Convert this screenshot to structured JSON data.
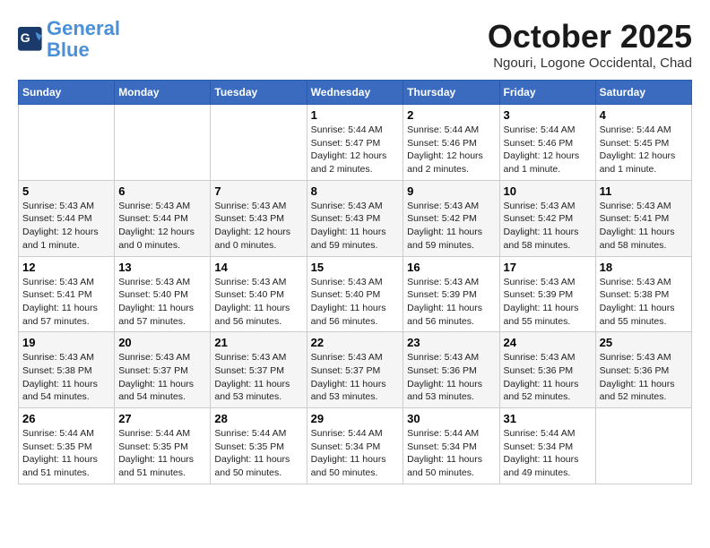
{
  "logo": {
    "line1": "General",
    "line2": "Blue"
  },
  "title": "October 2025",
  "location": "Ngouri, Logone Occidental, Chad",
  "days_of_week": [
    "Sunday",
    "Monday",
    "Tuesday",
    "Wednesday",
    "Thursday",
    "Friday",
    "Saturday"
  ],
  "weeks": [
    [
      {
        "day": "",
        "text": ""
      },
      {
        "day": "",
        "text": ""
      },
      {
        "day": "",
        "text": ""
      },
      {
        "day": "1",
        "text": "Sunrise: 5:44 AM\nSunset: 5:47 PM\nDaylight: 12 hours\nand 2 minutes."
      },
      {
        "day": "2",
        "text": "Sunrise: 5:44 AM\nSunset: 5:46 PM\nDaylight: 12 hours\nand 2 minutes."
      },
      {
        "day": "3",
        "text": "Sunrise: 5:44 AM\nSunset: 5:46 PM\nDaylight: 12 hours\nand 1 minute."
      },
      {
        "day": "4",
        "text": "Sunrise: 5:44 AM\nSunset: 5:45 PM\nDaylight: 12 hours\nand 1 minute."
      }
    ],
    [
      {
        "day": "5",
        "text": "Sunrise: 5:43 AM\nSunset: 5:44 PM\nDaylight: 12 hours\nand 1 minute."
      },
      {
        "day": "6",
        "text": "Sunrise: 5:43 AM\nSunset: 5:44 PM\nDaylight: 12 hours\nand 0 minutes."
      },
      {
        "day": "7",
        "text": "Sunrise: 5:43 AM\nSunset: 5:43 PM\nDaylight: 12 hours\nand 0 minutes."
      },
      {
        "day": "8",
        "text": "Sunrise: 5:43 AM\nSunset: 5:43 PM\nDaylight: 11 hours\nand 59 minutes."
      },
      {
        "day": "9",
        "text": "Sunrise: 5:43 AM\nSunset: 5:42 PM\nDaylight: 11 hours\nand 59 minutes."
      },
      {
        "day": "10",
        "text": "Sunrise: 5:43 AM\nSunset: 5:42 PM\nDaylight: 11 hours\nand 58 minutes."
      },
      {
        "day": "11",
        "text": "Sunrise: 5:43 AM\nSunset: 5:41 PM\nDaylight: 11 hours\nand 58 minutes."
      }
    ],
    [
      {
        "day": "12",
        "text": "Sunrise: 5:43 AM\nSunset: 5:41 PM\nDaylight: 11 hours\nand 57 minutes."
      },
      {
        "day": "13",
        "text": "Sunrise: 5:43 AM\nSunset: 5:40 PM\nDaylight: 11 hours\nand 57 minutes."
      },
      {
        "day": "14",
        "text": "Sunrise: 5:43 AM\nSunset: 5:40 PM\nDaylight: 11 hours\nand 56 minutes."
      },
      {
        "day": "15",
        "text": "Sunrise: 5:43 AM\nSunset: 5:40 PM\nDaylight: 11 hours\nand 56 minutes."
      },
      {
        "day": "16",
        "text": "Sunrise: 5:43 AM\nSunset: 5:39 PM\nDaylight: 11 hours\nand 56 minutes."
      },
      {
        "day": "17",
        "text": "Sunrise: 5:43 AM\nSunset: 5:39 PM\nDaylight: 11 hours\nand 55 minutes."
      },
      {
        "day": "18",
        "text": "Sunrise: 5:43 AM\nSunset: 5:38 PM\nDaylight: 11 hours\nand 55 minutes."
      }
    ],
    [
      {
        "day": "19",
        "text": "Sunrise: 5:43 AM\nSunset: 5:38 PM\nDaylight: 11 hours\nand 54 minutes."
      },
      {
        "day": "20",
        "text": "Sunrise: 5:43 AM\nSunset: 5:37 PM\nDaylight: 11 hours\nand 54 minutes."
      },
      {
        "day": "21",
        "text": "Sunrise: 5:43 AM\nSunset: 5:37 PM\nDaylight: 11 hours\nand 53 minutes."
      },
      {
        "day": "22",
        "text": "Sunrise: 5:43 AM\nSunset: 5:37 PM\nDaylight: 11 hours\nand 53 minutes."
      },
      {
        "day": "23",
        "text": "Sunrise: 5:43 AM\nSunset: 5:36 PM\nDaylight: 11 hours\nand 53 minutes."
      },
      {
        "day": "24",
        "text": "Sunrise: 5:43 AM\nSunset: 5:36 PM\nDaylight: 11 hours\nand 52 minutes."
      },
      {
        "day": "25",
        "text": "Sunrise: 5:43 AM\nSunset: 5:36 PM\nDaylight: 11 hours\nand 52 minutes."
      }
    ],
    [
      {
        "day": "26",
        "text": "Sunrise: 5:44 AM\nSunset: 5:35 PM\nDaylight: 11 hours\nand 51 minutes."
      },
      {
        "day": "27",
        "text": "Sunrise: 5:44 AM\nSunset: 5:35 PM\nDaylight: 11 hours\nand 51 minutes."
      },
      {
        "day": "28",
        "text": "Sunrise: 5:44 AM\nSunset: 5:35 PM\nDaylight: 11 hours\nand 50 minutes."
      },
      {
        "day": "29",
        "text": "Sunrise: 5:44 AM\nSunset: 5:34 PM\nDaylight: 11 hours\nand 50 minutes."
      },
      {
        "day": "30",
        "text": "Sunrise: 5:44 AM\nSunset: 5:34 PM\nDaylight: 11 hours\nand 50 minutes."
      },
      {
        "day": "31",
        "text": "Sunrise: 5:44 AM\nSunset: 5:34 PM\nDaylight: 11 hours\nand 49 minutes."
      },
      {
        "day": "",
        "text": ""
      }
    ]
  ]
}
